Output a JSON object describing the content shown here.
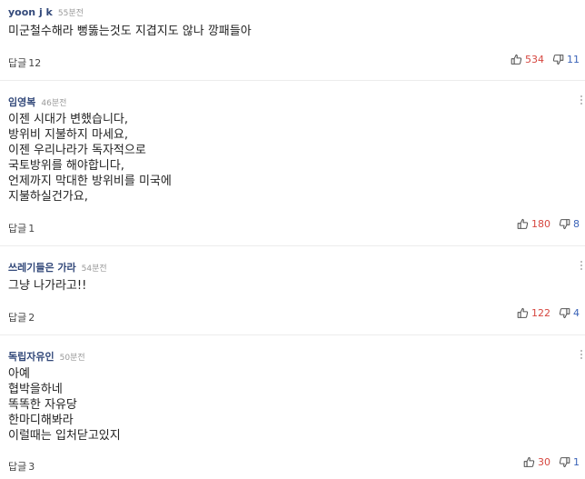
{
  "reply_label": "답글",
  "colors": {
    "author": "#33497a",
    "like": "#d6463f",
    "dislike": "#3a63b8",
    "time": "#999999"
  },
  "icons": {
    "like": "thumbs-up-icon",
    "dislike": "thumbs-down-icon",
    "more": "more-vertical-icon"
  },
  "comments": [
    {
      "author": "yoon j k",
      "time": "55분전",
      "lines": [
        "미군철수해라  뻥뚫는것도  지겹지도 않나 깡패들아"
      ],
      "replies": "12",
      "likes": "534",
      "dislikes": "11"
    },
    {
      "author": "임영복",
      "time": "46분전",
      "lines": [
        "이젠 시대가 변했습니다,",
        "방위비 지불하지 마세요,",
        "이젠 우리나라가 독자적으로",
        "국토방위를 해야합니다,",
        "언제까지 막대한 방위비를 미국에",
        "지불하실건가요,"
      ],
      "replies": "1",
      "likes": "180",
      "dislikes": "8"
    },
    {
      "author": "쓰레기들은 가라",
      "time": "54분전",
      "lines": [
        "그냥 나가라고!!"
      ],
      "replies": "2",
      "likes": "122",
      "dislikes": "4"
    },
    {
      "author": "독립자유인",
      "time": "50분전",
      "lines": [
        "아예",
        "협박을하네",
        "똑똑한 자유당",
        "한마디해봐라",
        "이럴때는 입처닫고있지"
      ],
      "replies": "3",
      "likes": "30",
      "dislikes": "1"
    }
  ]
}
